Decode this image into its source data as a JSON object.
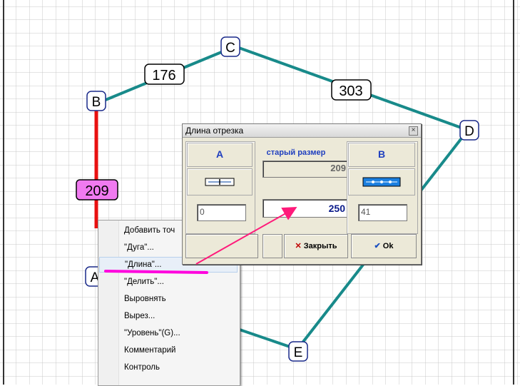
{
  "graph": {
    "nodes": [
      {
        "label": "A"
      },
      {
        "label": "B"
      },
      {
        "label": "C"
      },
      {
        "label": "D"
      },
      {
        "label": "E"
      }
    ],
    "edge_labels": [
      {
        "text": "176",
        "edge": "B-C"
      },
      {
        "text": "303",
        "edge": "C-D"
      },
      {
        "text": "209",
        "edge": "A-B",
        "selected": true
      }
    ],
    "colors": {
      "edge": "#188a8a",
      "selected_edge": "#e81010",
      "selected_label_bg": "#f07af0",
      "grid": "#c8c8c8",
      "annotation": "#ff00aa"
    }
  },
  "dialog": {
    "title": "Длина отрезка",
    "close_glyph": "×",
    "col_a": "A",
    "col_b": "B",
    "old_size_label": "старый размер",
    "old_size_value": "209",
    "new_size_value": "250",
    "a_value": "0",
    "b_value": "41",
    "close_button": "Закрыть",
    "ok_button": "Ok"
  },
  "context_menu": {
    "items": [
      "Добавить точ",
      "\"Дуга\"...",
      "\"Длина\"...",
      "\"Делить\"...",
      "Выровнять",
      "Вырез...",
      "\"Уровень\"(G)...",
      "Комментарий",
      "Контроль"
    ],
    "highlighted": 2
  }
}
